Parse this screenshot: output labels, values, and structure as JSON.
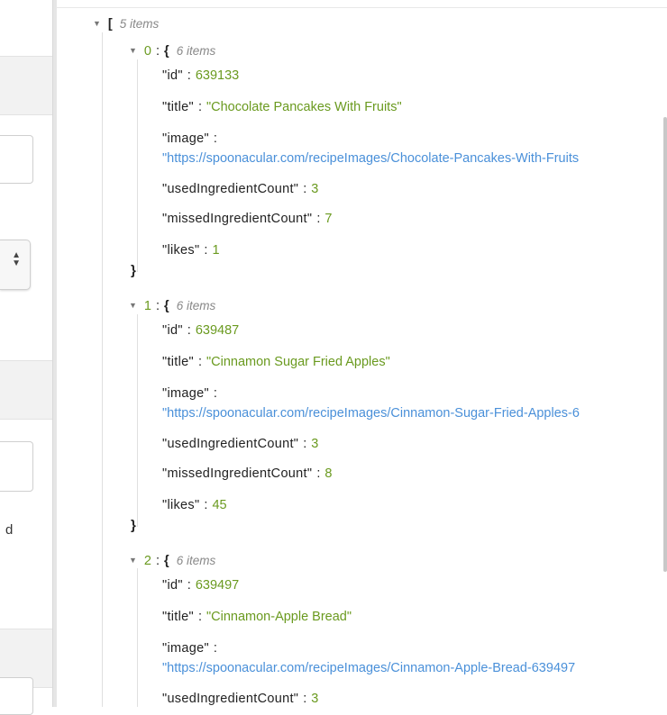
{
  "left_panel": {
    "fragment_text": "d"
  },
  "root": {
    "bracket": "[",
    "meta": "5 items"
  },
  "objects": [
    {
      "index": "0",
      "brace": "{",
      "meta": "6 items",
      "fields": [
        {
          "key": "\"id\"",
          "value": "639133"
        },
        {
          "key": "\"title\"",
          "value": "\"Chocolate Pancakes With Fruits\""
        },
        {
          "key": "\"image\"",
          "value": "\"https://spoonacular.com/recipeImages/Chocolate-Pancakes-With-Fruits"
        },
        {
          "key": "\"usedIngredientCount\"",
          "value": "3"
        },
        {
          "key": "\"missedIngredientCount\"",
          "value": "7"
        },
        {
          "key": "\"likes\"",
          "value": "1"
        }
      ],
      "close": "}"
    },
    {
      "index": "1",
      "brace": "{",
      "meta": "6 items",
      "fields": [
        {
          "key": "\"id\"",
          "value": "639487"
        },
        {
          "key": "\"title\"",
          "value": "\"Cinnamon Sugar Fried Apples\""
        },
        {
          "key": "\"image\"",
          "value": "\"https://spoonacular.com/recipeImages/Cinnamon-Sugar-Fried-Apples-6"
        },
        {
          "key": "\"usedIngredientCount\"",
          "value": "3"
        },
        {
          "key": "\"missedIngredientCount\"",
          "value": "8"
        },
        {
          "key": "\"likes\"",
          "value": "45"
        }
      ],
      "close": "}"
    },
    {
      "index": "2",
      "brace": "{",
      "meta": "6 items",
      "fields": [
        {
          "key": "\"id\"",
          "value": "639497"
        },
        {
          "key": "\"title\"",
          "value": "\"Cinnamon-Apple Bread\""
        },
        {
          "key": "\"image\"",
          "value": "\"https://spoonacular.com/recipeImages/Cinnamon-Apple-Bread-639497"
        },
        {
          "key": "\"usedIngredientCount\"",
          "value": "3"
        }
      ]
    }
  ]
}
